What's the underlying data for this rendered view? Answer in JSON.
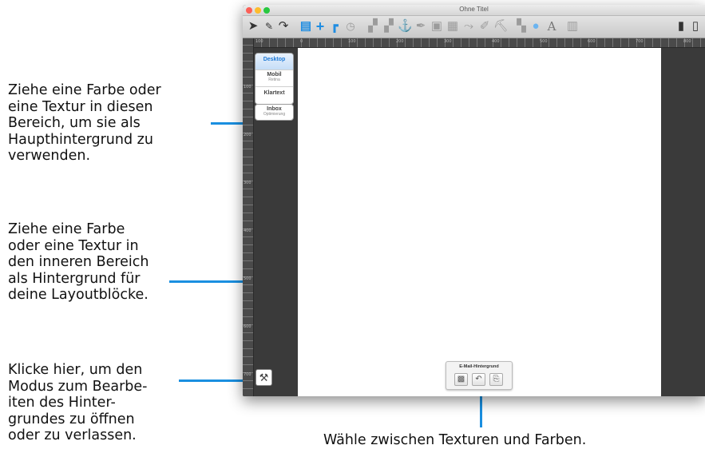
{
  "annotations": {
    "main_background": "Ziehe eine Farbe oder\neine Textur in diesen\nBereich, um sie als\nHaupthintergrund zu\nverwenden.",
    "inner_background": "Ziehe eine Farbe\noder eine Textur in\nden inneren Bereich\nals Hintergrund für\ndeine Layoutblöcke.",
    "edit_mode": "Klicke hier, um den\nModus zum Bearbe-\niten des Hinter-\ngrundes zu öffnen\noder zu verlassen.",
    "texture_color": "Wähle zwischen Texturen und Farben."
  },
  "window": {
    "title": "Ohne Titel"
  },
  "toolbar": {
    "icons": [
      "pointer-icon",
      "text-tool-icon",
      "redo-icon",
      "layout-block-icon",
      "add-icon",
      "corner-icon",
      "clock-icon",
      "align-icon",
      "align-icon",
      "anchor-icon",
      "pen-icon",
      "image-icon",
      "image-icon",
      "text-path-icon",
      "brush-icon",
      "fill-icon",
      "palette-icon",
      "color-picker-icon",
      "font-icon",
      "calculator-icon",
      "phone-icon",
      "tablet-icon"
    ],
    "font_glyph": "A"
  },
  "ruler": {
    "h_labels": [
      "100",
      "0",
      "100",
      "200",
      "300",
      "400",
      "500",
      "600",
      "700",
      "800"
    ],
    "v_labels": [
      "100",
      "200",
      "300",
      "400",
      "500",
      "600",
      "700"
    ]
  },
  "sidebar": {
    "segments": [
      {
        "label": "Desktop",
        "sub": "",
        "active": true
      },
      {
        "label": "Mobil",
        "sub": "Retina",
        "active": false
      },
      {
        "label": "Klartext",
        "sub": "",
        "active": false
      }
    ],
    "inbox": {
      "label": "Inbox",
      "sub": "Optimierung"
    }
  },
  "background_panel": {
    "title": "E-Mail-Hintergrund",
    "buttons": [
      "texture-icon",
      "undo-icon",
      "paste-icon"
    ]
  },
  "colors": {
    "accent": "#1a8fe0",
    "dark_area": "#3a3a3a",
    "canvas": "#ffffff"
  }
}
